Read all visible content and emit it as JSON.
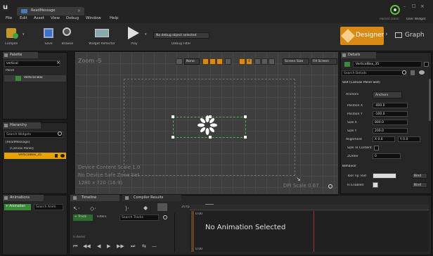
{
  "app": {
    "tab_title": "ReadMessage",
    "menu": [
      "File",
      "Edit",
      "Asset",
      "View",
      "Debug",
      "Window",
      "Help"
    ],
    "parent_class": "Parent class:",
    "parent_class_value": "User Widget"
  },
  "toolbar": {
    "buttons": [
      "Compile",
      "Save",
      "Browse",
      "Widget Reflector",
      "Play"
    ],
    "debug_object": "No debug object selected",
    "debug_filter": "Debug Filter",
    "designer": "Designer",
    "graph": "Graph"
  },
  "palette": {
    "title": "Palette",
    "search_value": "vertical",
    "category": "Panel",
    "item": "Vertical Box"
  },
  "hierarchy": {
    "title": "Hierarchy",
    "search_placeholder": "Search Widgets",
    "items": [
      "[ReadMessage]",
      "[Canvas Panel]",
      "VerticalBox_35"
    ]
  },
  "viewport": {
    "zoom": "Zoom -5",
    "toolbar": {
      "none_label": "None",
      "grid_size": "4",
      "screen_size": "Screen Size",
      "fill_screen": "Fill Screen"
    },
    "content_scale": "Device Content Scale 1.0",
    "safe_zone": "No Device Safe Zone Set",
    "resolution": "1280 x 720 (16:9)",
    "dpi": "DPI Scale 0.67"
  },
  "details": {
    "title": "Details",
    "widget_name": "VerticalBox_35",
    "search_placeholder": "Search Details",
    "slot_section": "Slot (Canvas Panel Slot)",
    "anchors_label": "Anchors",
    "anchors_value": "Anchors",
    "fields": [
      {
        "label": "Position X",
        "value": "-400.0"
      },
      {
        "label": "Position Y",
        "value": "-100.0"
      },
      {
        "label": "Size X",
        "value": "800.0"
      },
      {
        "label": "Size Y",
        "value": "200.0"
      }
    ],
    "alignment_label": "Alignment",
    "alignment_x": "X 0.0",
    "alignment_y": "Y 0.0",
    "size_to_content": "Size To Content",
    "zorder_label": "ZOrder",
    "zorder_value": "0",
    "behavior_section": "Behavior",
    "tooltip_label": "Tool Tip Text",
    "tooltip_bind": "Bind",
    "enabled_label": "Is Enabled",
    "enabled_bind": "Bind"
  },
  "animations": {
    "title": "Animations",
    "add_button": "+ Animation",
    "search_placeholder": "Search Anim"
  },
  "timeline": {
    "tab1": "Timeline",
    "tab2": "Compiler Results",
    "fps": "20 fps",
    "track_btn": "+ Track",
    "filters": "Filters",
    "search_tracks": "Search Tracks",
    "time_start": "0.00",
    "no_animation": "No Animation Selected",
    "items_count": "0 items",
    "time_end": "0.00"
  },
  "colors": {
    "accent_orange": "#d98a16",
    "selection_yellow": "#e7a400",
    "green": "#5fbf3a"
  }
}
